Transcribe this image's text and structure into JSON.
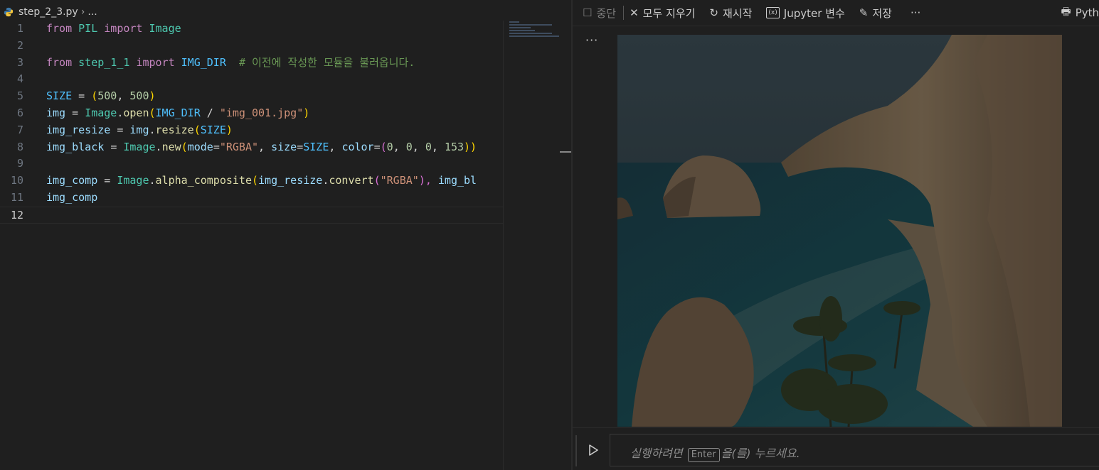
{
  "breadcrumb": {
    "file": "step_2_3.py",
    "more": "..."
  },
  "code_lines": [
    {
      "n": "1"
    },
    {
      "n": "2"
    },
    {
      "n": "3"
    },
    {
      "n": "4"
    },
    {
      "n": "5"
    },
    {
      "n": "6"
    },
    {
      "n": "7"
    },
    {
      "n": "8"
    },
    {
      "n": "9"
    },
    {
      "n": "10"
    },
    {
      "n": "11"
    },
    {
      "n": "12"
    }
  ],
  "code_tokens": {
    "l1": [
      "from",
      "PIL",
      "import",
      "Image"
    ],
    "l3": [
      "from",
      "step_1_1",
      "import",
      "IMG_DIR",
      "# 이전에 작성한 모듈을 불러옵니다."
    ],
    "l5": [
      "SIZE",
      "=",
      "(",
      "500",
      ", ",
      "500",
      ")"
    ],
    "l6": [
      "img",
      "=",
      "Image",
      ".",
      "open",
      "(",
      "IMG_DIR",
      "/",
      "\"img_001.jpg\"",
      ")"
    ],
    "l7": [
      "img_resize",
      "=",
      "img",
      ".",
      "resize",
      "(",
      "SIZE",
      ")"
    ],
    "l8": [
      "img_black",
      "=",
      "Image",
      ".",
      "new",
      "(",
      "mode",
      "=",
      "\"RGBA\"",
      ", ",
      "size",
      "=",
      "SIZE",
      ", ",
      "color",
      "=",
      "(",
      "0",
      ", ",
      "0",
      ", ",
      "0",
      ", ",
      "153",
      "))"
    ],
    "l10": [
      "img_comp",
      "=",
      "Image",
      ".",
      "alpha_composite",
      "(",
      "img_resize",
      ".",
      "convert",
      "(",
      "\"RGBA\"",
      "), ",
      "img_bl"
    ],
    "l11": [
      "img_comp"
    ]
  },
  "toolbar": {
    "interrupt": "중단",
    "clear_all": "모두 지우기",
    "restart": "재시작",
    "variables": "Jupyter 변수",
    "save": "저장",
    "more": "···",
    "kernel": "Pyth"
  },
  "output": {
    "more": "···"
  },
  "input": {
    "placeholder_before": "실행하려면",
    "enter_key": "Enter",
    "placeholder_after": "을(를) 누르세요."
  },
  "colors": {
    "keyword": "#c586c0",
    "class": "#4ec9b0",
    "constant": "#4fc1ff",
    "variable": "#9cdcfe",
    "function": "#dcdcaa",
    "string": "#ce9178",
    "number": "#b5cea8",
    "comment": "#6a9955",
    "background": "#1f1f1f"
  },
  "icons": {
    "breadcrumb": "python-file-icon",
    "interrupt": "stop-square-icon",
    "clear": "close-icon",
    "restart": "restart-icon",
    "variables": "variables-icon",
    "save": "save-icon",
    "kernel": "kernel-icon",
    "run": "play-icon"
  }
}
